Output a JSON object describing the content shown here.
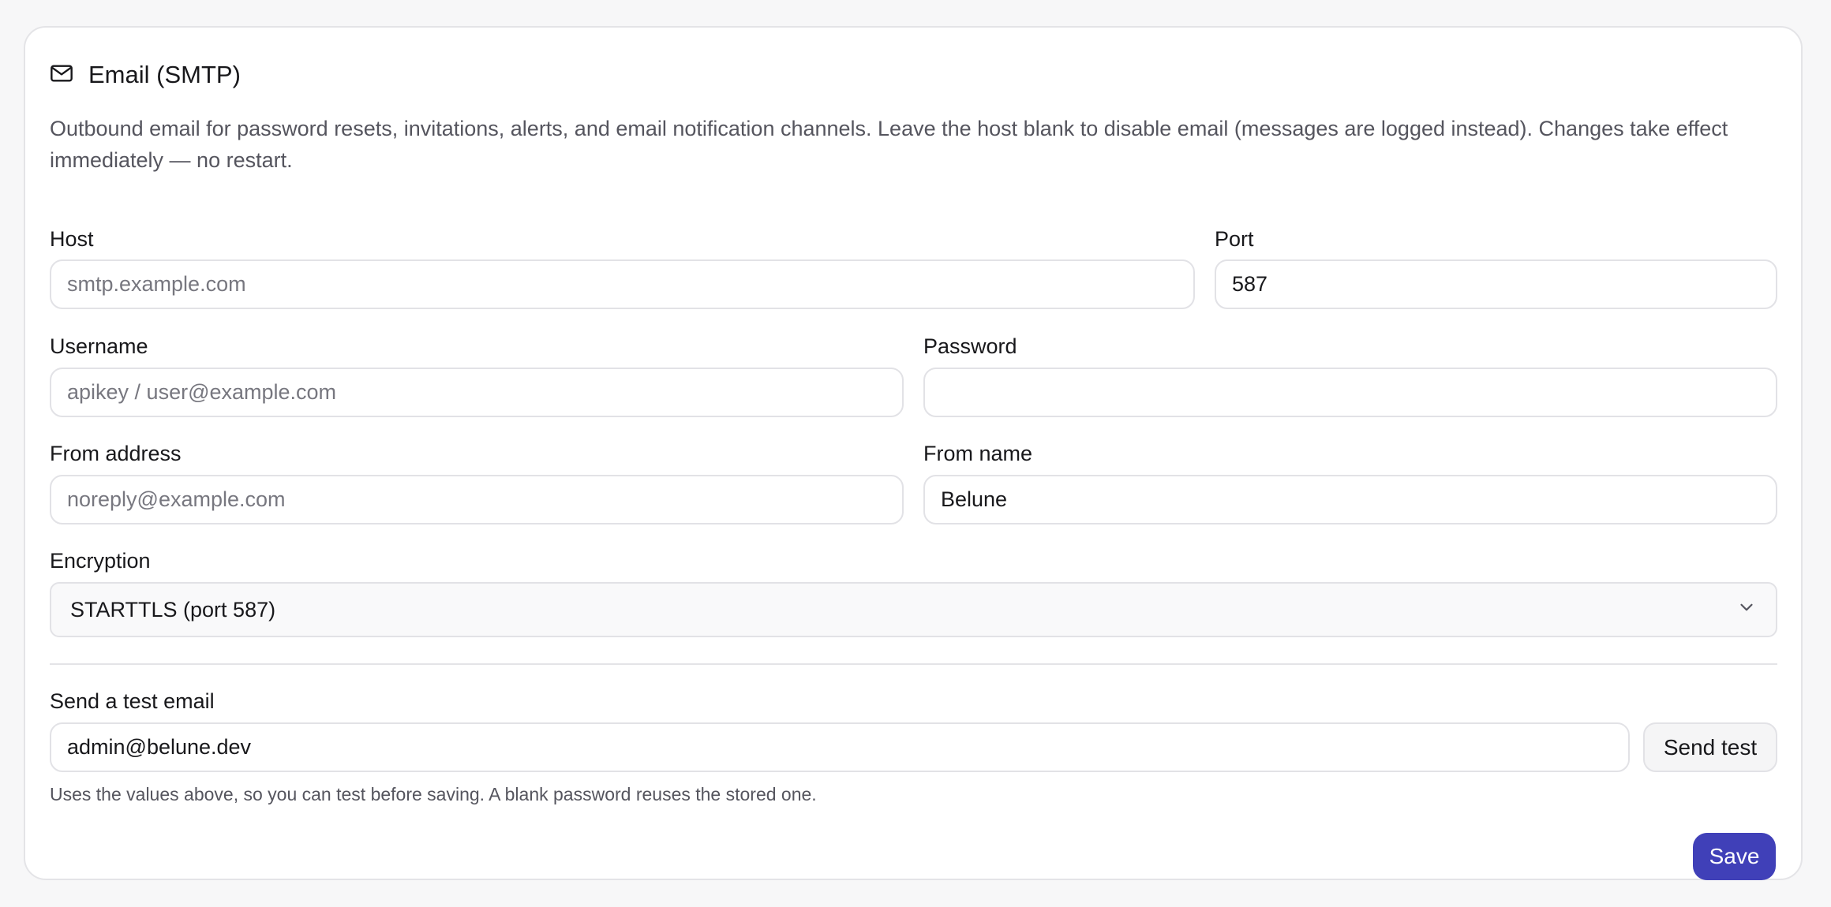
{
  "section": {
    "title": "Email (SMTP)",
    "icon": "mail-icon",
    "description": "Outbound email for password resets, invitations, alerts, and email notification channels. Leave the host blank to disable email (messages are logged instead). Changes take effect immediately — no restart."
  },
  "fields": {
    "host": {
      "label": "Host",
      "value": "",
      "placeholder": "smtp.example.com"
    },
    "port": {
      "label": "Port",
      "value": "587",
      "placeholder": ""
    },
    "username": {
      "label": "Username",
      "value": "",
      "placeholder": "apikey / user@example.com"
    },
    "password": {
      "label": "Password",
      "value": "",
      "placeholder": ""
    },
    "from_address": {
      "label": "From address",
      "value": "",
      "placeholder": "noreply@example.com"
    },
    "from_name": {
      "label": "From name",
      "value": "Belune",
      "placeholder": ""
    },
    "encryption": {
      "label": "Encryption",
      "selected": "STARTTLS (port 587)",
      "icon": "chevron-down-icon"
    }
  },
  "test_email": {
    "label": "Send a test email",
    "value": "admin@belune.dev",
    "button_label": "Send test",
    "hint": "Uses the values above, so you can test before saving. A blank password reuses the stored one."
  },
  "actions": {
    "save_label": "Save"
  },
  "colors": {
    "primary": "#4040b8",
    "border": "#e2e2e6",
    "muted_text": "#55555e"
  }
}
